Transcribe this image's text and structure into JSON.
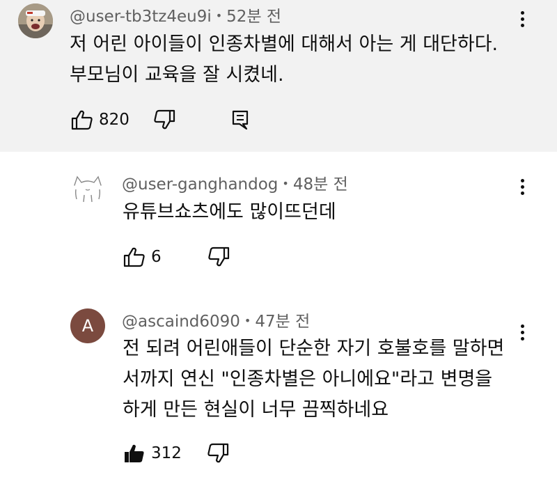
{
  "comments": [
    {
      "author": "@user-tb3tz4eu9i",
      "time": "52분 전",
      "lines": [
        "저 어린 아이들이 인종차별에 대해서 아는 게 대단하다.",
        "부모님이 교육을 잘 시켰네."
      ],
      "likes": "820",
      "avatar_icon": "photo-avatar"
    },
    {
      "author": "@user-ganghandog",
      "time": "48분 전",
      "lines": [
        "유튜브쇼츠에도 많이뜨던데"
      ],
      "likes": "6",
      "avatar_icon": "cat-sketch-avatar"
    },
    {
      "author": "@ascaind6090",
      "time": "47분 전",
      "lines": [
        "전 되려 어린애들이 단순한 자기 호불호를 말하면",
        "서까지 연신 \"인종차별은 아니에요\"라고 변명을",
        "하게 만든 현실이 너무 끔찍하네요"
      ],
      "likes": "312",
      "avatar_letter": "A",
      "avatar_color": "#7b4a3f"
    }
  ],
  "colors": {
    "highlight_bg": "#f2f2f2",
    "meta_text": "#606060",
    "body_text": "#0f0f0f"
  }
}
